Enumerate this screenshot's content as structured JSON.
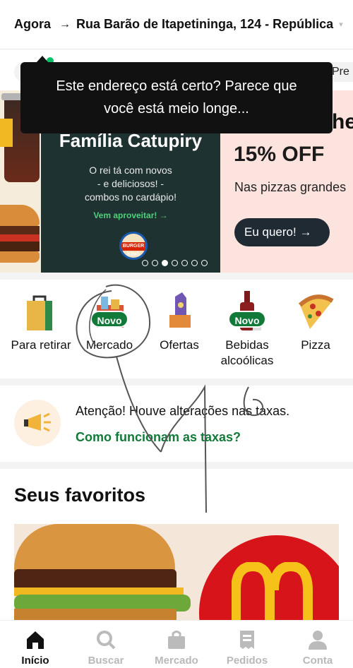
{
  "header": {
    "when": "Agora",
    "arrow": "→",
    "address": "Rua Barão de Itapetininga, 124 - República"
  },
  "filters": {
    "partial_chip": "Pre"
  },
  "tooltip": {
    "line1": "Este endereço está certo? Parece que",
    "line2": "você está meio longe..."
  },
  "banner": {
    "main": {
      "title": "Família Catupiry",
      "sub1": "O rei tá com novos",
      "sub2": "- e deliciosos! -",
      "sub3": "combos no cardápio!",
      "cta": "Vem aproveitar! →",
      "logo": "BURGER KING"
    },
    "right": {
      "partial_title": "he",
      "discount": "15% OFF",
      "desc": "Nas pizzas grandes",
      "button": "Eu quero! →"
    },
    "dots_count": 7,
    "active_dot": 3
  },
  "categories": [
    {
      "label": "Para retirar",
      "icon": "takeout-bag-icon",
      "badge": ""
    },
    {
      "label": "Mercado",
      "icon": "grocery-icon",
      "badge": "Novo"
    },
    {
      "label": "Ofertas",
      "icon": "offers-tag-icon",
      "badge": ""
    },
    {
      "label": "Bebidas alcoólicas",
      "label1": "Bebidas",
      "label2": "alcoólicas",
      "icon": "wine-bottle-icon",
      "badge": "Novo"
    },
    {
      "label": "Pizza",
      "icon": "pizza-icon",
      "badge": ""
    }
  ],
  "notice": {
    "text": "Atenção! Houve alterações nas taxas.",
    "link": "Como funcionam as taxas?"
  },
  "favorites": {
    "title": "Seus favoritos"
  },
  "bottom_nav": [
    {
      "label": "Início",
      "icon": "home-icon",
      "active": true
    },
    {
      "label": "Buscar",
      "icon": "search-icon",
      "active": false
    },
    {
      "label": "Mercado",
      "icon": "shopping-bag-icon",
      "active": false
    },
    {
      "label": "Pedidos",
      "icon": "receipt-icon",
      "active": false
    },
    {
      "label": "Conta",
      "icon": "person-icon",
      "active": false
    }
  ],
  "colors": {
    "accent_green": "#127a38",
    "dark_banner": "#1f3232",
    "pink_banner": "#fde3de"
  }
}
